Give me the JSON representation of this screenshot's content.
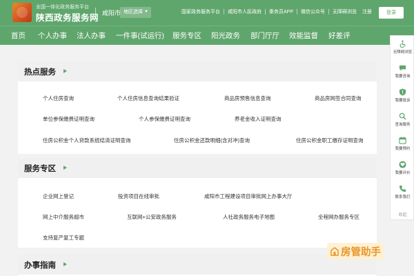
{
  "header": {
    "brand_sub": "全国一体化政务服务平台",
    "brand_main": "陕西政务服务网",
    "city": "咸阳市",
    "region_select": "地区选择",
    "links": [
      "国家政务服务平台",
      "咸阳市人民政府",
      "秦务员APP",
      "微信公众号",
      "无障碍浏览"
    ],
    "register": "注册",
    "login": "登录",
    "accent": "#5fa66c"
  },
  "nav": {
    "items": [
      "首页",
      "个人办事",
      "法人办事",
      "一件事(试运行)",
      "服务专区",
      "阳光政务",
      "部门厅厅",
      "效能监督",
      "好差评"
    ]
  },
  "hot_services": {
    "title": "热点服务",
    "links": [
      "个人住房查询",
      "个人住房信息查询结果验证",
      "商品房预售信息查询",
      "商品房网签合同查询",
      "单位参保缴费证明查询",
      "个人参保缴费证明查询",
      "养老金收入证明查询",
      "住房公积金个人贷款系统结清证明查询",
      "住房公积金还款明细(含对冲)查询",
      "住房公积金职工缴存证明查询"
    ]
  },
  "service_zone": {
    "title": "服务专区",
    "links": [
      "企业网上登记",
      "投资项目在线审批",
      "咸阳市工程建设项目审批网上办事大厅",
      "网上中介服务超市",
      "互联网+公安政务服务",
      "人社政务服务电子地图",
      "全程网办服务专区",
      "支持复产复工专题"
    ]
  },
  "guide": {
    "title": "办事指南"
  },
  "sidebar": {
    "items": [
      {
        "label": "无障碍浏览",
        "icon": "accessibility-icon"
      },
      {
        "label": "我要咨询",
        "icon": "chat-icon"
      },
      {
        "label": "我要投诉",
        "icon": "shield-icon"
      },
      {
        "label": "查询服务",
        "icon": "search-icon"
      },
      {
        "label": "我要预约",
        "icon": "calendar-icon"
      },
      {
        "label": "我要评价",
        "icon": "heart-icon"
      },
      {
        "label": "联系我们",
        "icon": "phone-icon"
      }
    ],
    "collapse": "收起"
  },
  "watermark": {
    "text": "房管助手"
  }
}
